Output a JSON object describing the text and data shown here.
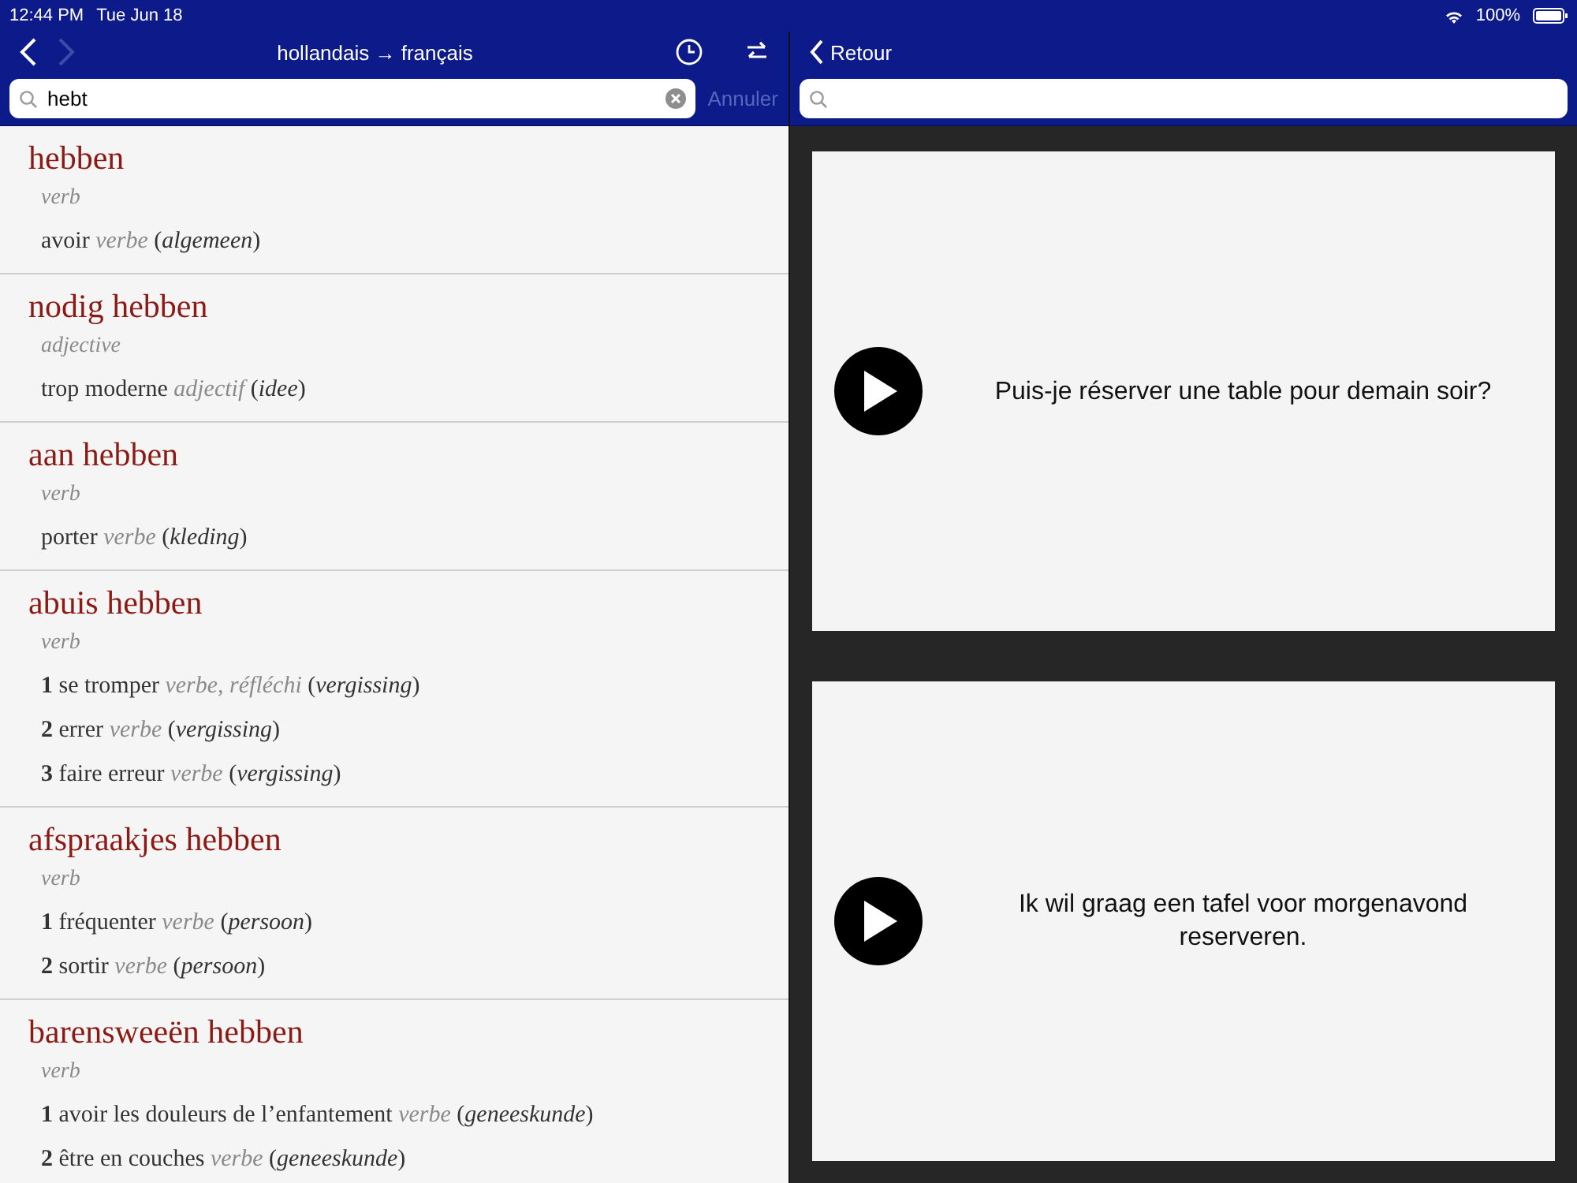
{
  "status_bar": {
    "time": "12:44 PM",
    "date": "Tue Jun 18",
    "battery_text": "100%"
  },
  "left_nav": {
    "title": "hollandais → français",
    "back_disabled": false,
    "forward_disabled": true
  },
  "search": {
    "value": "hebt",
    "cancel": "Annuler"
  },
  "entries": [
    {
      "headword": "hebben",
      "pos": "verb",
      "senses": [
        {
          "text": "avoir",
          "pos": "verbe",
          "context": "(*algemeen*)"
        }
      ]
    },
    {
      "headword": "nodig hebben",
      "pos": "adjective",
      "senses": [
        {
          "text": "trop moderne",
          "pos": "adjectif",
          "context": "(*idee*)"
        }
      ]
    },
    {
      "headword": "aan hebben",
      "pos": "verb",
      "senses": [
        {
          "text": "porter",
          "pos": "verbe",
          "context": "(*kleding*)"
        }
      ]
    },
    {
      "headword": "abuis hebben",
      "pos": "verb",
      "senses": [
        {
          "number": "1",
          "text": "se tromper",
          "pos": "verbe, réfléchi",
          "context": "(*vergissing*)"
        },
        {
          "number": "2",
          "text": "errer",
          "pos": "verbe",
          "context": "(*vergissing*)"
        },
        {
          "number": "3",
          "text": "faire erreur",
          "pos": "verbe",
          "context": "(*vergissing*)"
        }
      ]
    },
    {
      "headword": "afspraakjes hebben",
      "pos": "verb",
      "senses": [
        {
          "number": "1",
          "text": "fréquenter",
          "pos": "verbe",
          "context": "(*persoon*)"
        },
        {
          "number": "2",
          "text": "sortir",
          "pos": "verbe",
          "context": "(*persoon*)"
        }
      ]
    },
    {
      "headword": "barensweeën hebben",
      "pos": "verb",
      "senses": [
        {
          "number": "1",
          "text": "avoir les douleurs de l’enfantement",
          "pos": "verbe",
          "context": "(*geneeskunde*)"
        },
        {
          "number": "2",
          "text": "être en couches",
          "pos": "verbe",
          "context": "(*geneeskunde*)"
        }
      ]
    }
  ],
  "right_nav": {
    "back": "Retour"
  },
  "cards": [
    {
      "text": "Puis-je réserver une table pour demain soir?"
    },
    {
      "text": "Ik wil graag een tafel voor morgenavond reserveren."
    }
  ]
}
